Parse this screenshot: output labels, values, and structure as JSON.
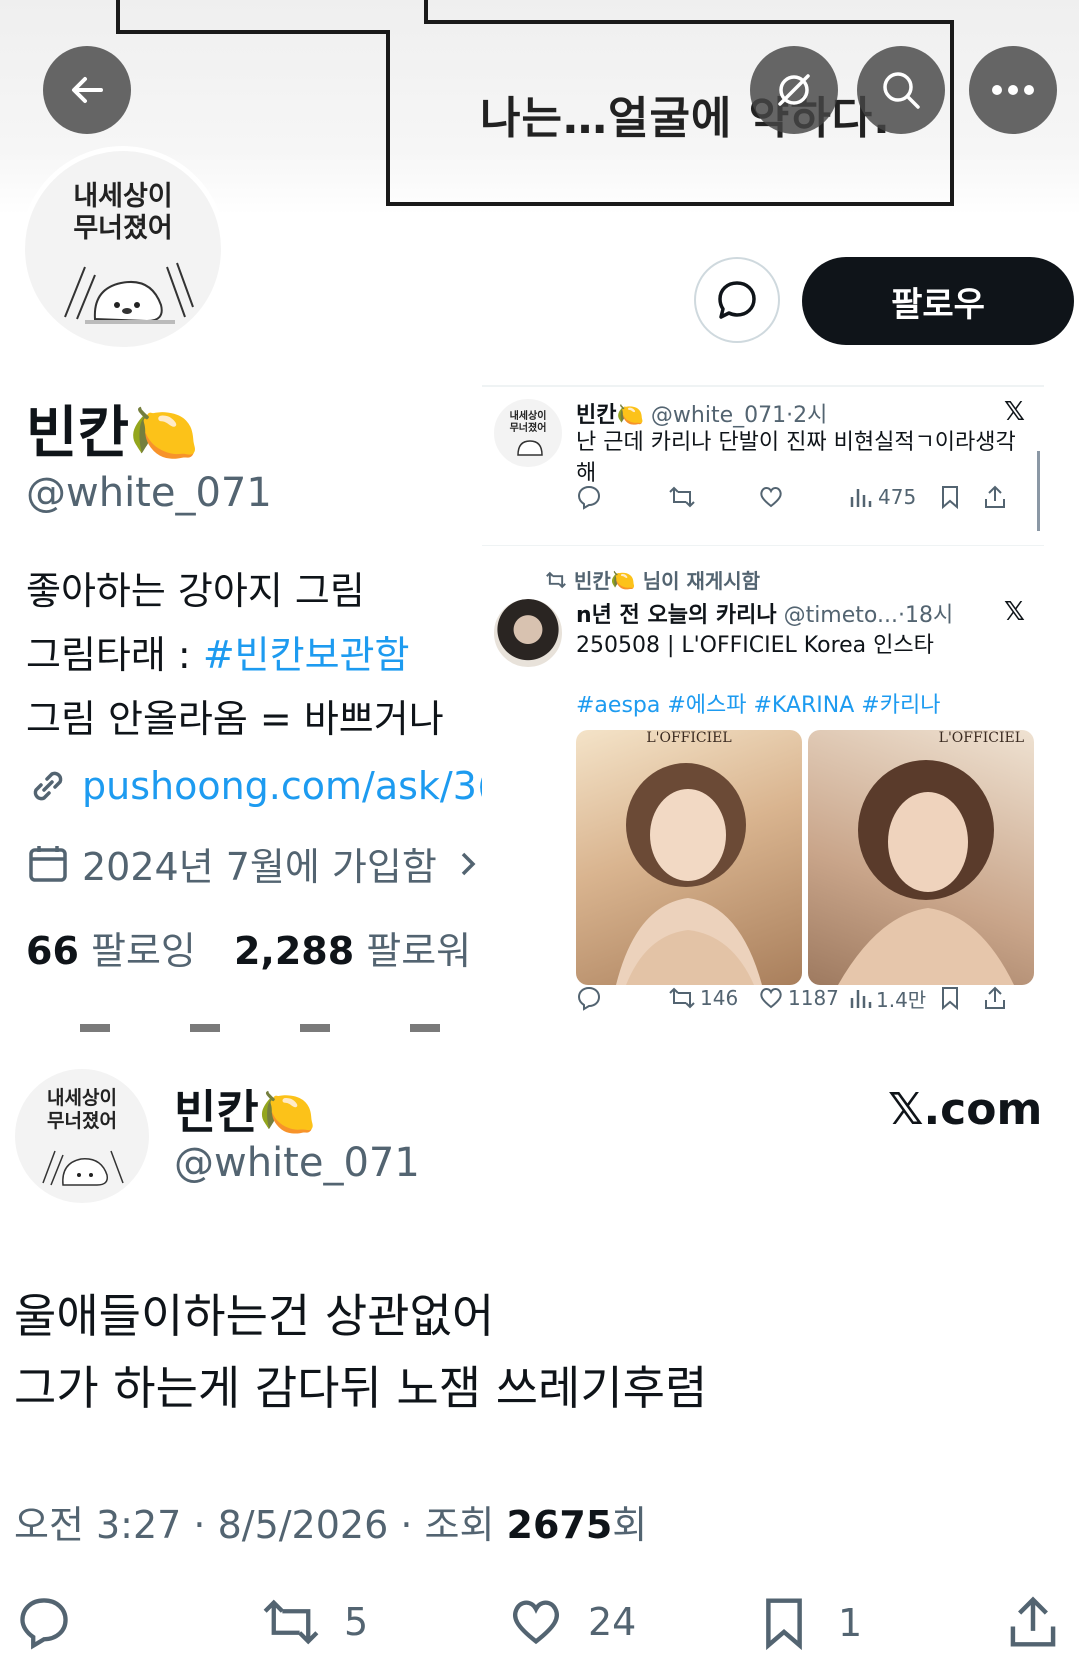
{
  "banner": {
    "comic_text": "나는…얼굴에 약하다."
  },
  "profile": {
    "avatar_lines": [
      "내세상이",
      "무너졌어"
    ],
    "display_name": "빈칸",
    "name_emoji": "🍋",
    "handle": "@white_071",
    "follow_label": "팔로우",
    "bio": {
      "line1": "좋아하는 강아지 그림",
      "line2_prefix": "그림타래 : ",
      "line2_tag": "#빈칸보관함",
      "line3": "그림 안올라옴 = 바쁘거나"
    },
    "link": "pushoong.com/ask/3(",
    "joined": "2024년 7월에 가입함",
    "following_count": "66",
    "following_label": "팔로잉",
    "followers_count": "2,288",
    "followers_label": "팔로워"
  },
  "tweet1": {
    "avatar_lines": [
      "내세상이",
      "무너졌어"
    ],
    "name": "빈칸",
    "emoji": "🍋",
    "handle": "@white_071",
    "time": "2시",
    "text_line1": "난 근데 카리나 단발이 진짜 비현실적ㄱ이라생각",
    "text_line2": "해",
    "views": "475"
  },
  "tweet2": {
    "repost_name": "빈칸",
    "repost_emoji": "🍋",
    "repost_label": "님이 재게시함",
    "name": "n년 전 오늘의 카리나",
    "handle": "@timeto...",
    "time": "18시",
    "text": "250508 | L'OFFICIEL Korea 인스타",
    "hashtags": "#aespa #에스파 #KARINA #카리나",
    "media_caption": "L'OFFICIEL",
    "retweets": "146",
    "likes": "1187",
    "views": "1.4만"
  },
  "quote": {
    "avatar_lines": [
      "내세상이",
      "무너졌어"
    ],
    "name": "빈칸",
    "emoji": "🍋",
    "handle": "@white_071",
    "site": "𝕏.com",
    "text_line1": "울애들이하는건 상관없어",
    "text_line2": "그가 하는게 감다뒤 노잼 쓰레기후렴",
    "time": "오전 3:27",
    "date": "8/5/2026",
    "views_label": "조회",
    "views": "2675",
    "views_suffix": "회",
    "retweets": "5",
    "likes": "24",
    "bookmarks": "1"
  },
  "colors": {
    "link_blue": "#1d9bf0",
    "text_primary": "#0f1419",
    "text_secondary": "#536471",
    "follow_bg": "#0f1419"
  }
}
